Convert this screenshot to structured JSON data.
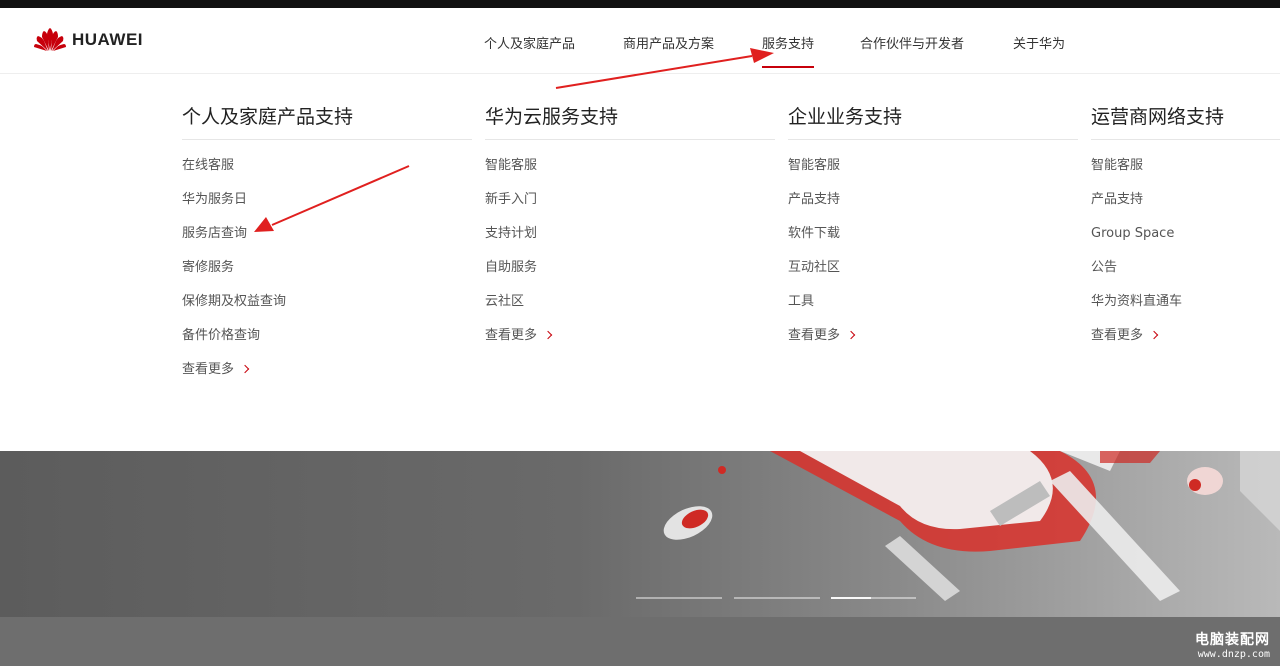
{
  "brand": {
    "name": "HUAWEI",
    "accent_color": "#c7000b",
    "logo_icon": "huawei-petal-logo-icon"
  },
  "nav": {
    "items": [
      {
        "label": "个人及家庭产品",
        "active": false
      },
      {
        "label": "商用产品及方案",
        "active": false
      },
      {
        "label": "服务支持",
        "active": true
      },
      {
        "label": "合作伙伴与开发者",
        "active": false
      },
      {
        "label": "关于华为",
        "active": false
      }
    ]
  },
  "dropdown": {
    "columns": [
      {
        "title": "个人及家庭产品支持",
        "links": [
          "在线客服",
          "华为服务日",
          "服务店查询",
          "寄修服务",
          "保修期及权益查询",
          "备件价格查询"
        ],
        "more": "查看更多"
      },
      {
        "title": "华为云服务支持",
        "links": [
          "智能客服",
          "新手入门",
          "支持计划",
          "自助服务",
          "云社区"
        ],
        "more": "查看更多"
      },
      {
        "title": "企业业务支持",
        "links": [
          "智能客服",
          "产品支持",
          "软件下载",
          "互动社区",
          "工具"
        ],
        "more": "查看更多"
      },
      {
        "title": "运营商网络支持",
        "links": [
          "智能客服",
          "产品支持",
          "Group Space",
          "公告",
          "华为资料直通车"
        ],
        "more": "查看更多"
      }
    ]
  },
  "annotations": {
    "arrow_color": "#e0201f"
  },
  "watermark": {
    "title": "电脑装配网",
    "url": "www.dnzp.com"
  }
}
